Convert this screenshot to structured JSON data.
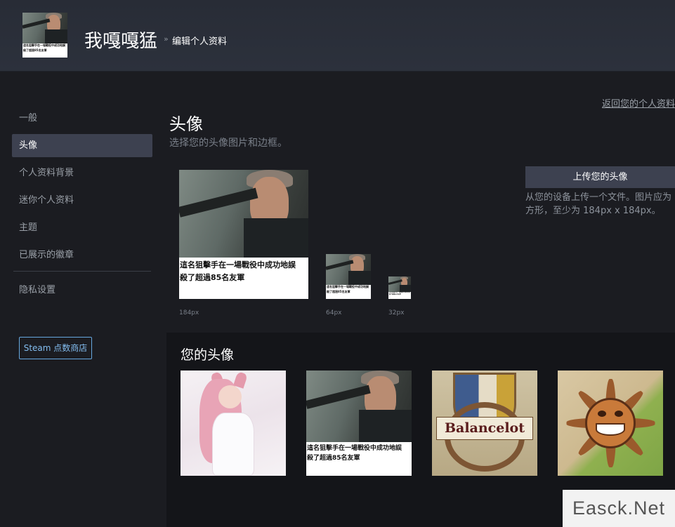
{
  "header": {
    "username": "我嘎嘎猛",
    "separator": "»",
    "breadcrumb": "编辑个人资料"
  },
  "avatar_caption": {
    "line1": "這名狙擊手在一場戰役中成功地誤",
    "line2": "殺了超過85名友軍"
  },
  "sidebar": {
    "items": [
      {
        "label": "一般",
        "active": false
      },
      {
        "label": "头像",
        "active": true
      },
      {
        "label": "个人资料背景",
        "active": false
      },
      {
        "label": "迷你个人资料",
        "active": false
      },
      {
        "label": "主题",
        "active": false
      },
      {
        "label": "已展示的徽章",
        "active": false
      }
    ],
    "privacy": "隐私设置",
    "points_shop": "Steam 点数商店"
  },
  "main": {
    "back_link": "返回您的个人资料",
    "section_title": "头像",
    "section_subtitle": "选择您的头像图片和边框。",
    "sizes": [
      "184px",
      "64px",
      "32px"
    ],
    "upload_button": "上传您的头像",
    "upload_desc": "从您的设备上传一个文件。图片应为方形，至少为 184px x 184px。",
    "your_avatars_title": "您的头像",
    "thumb_balance_text": "Balancelot"
  },
  "watermark": "Easck.Net"
}
